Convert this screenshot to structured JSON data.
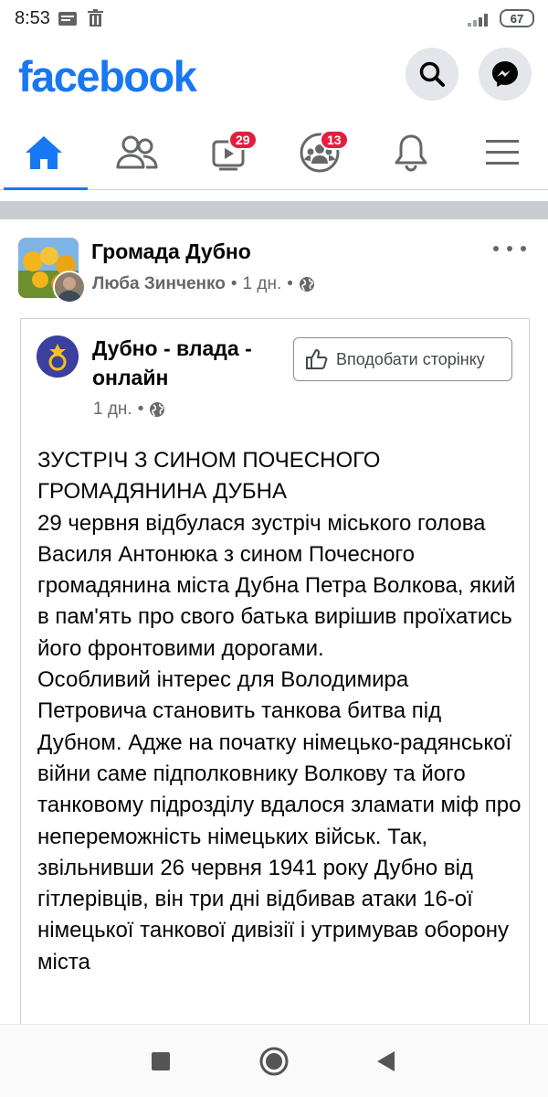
{
  "status_bar": {
    "time": "8:53",
    "battery": "67"
  },
  "header": {
    "logo": "facebook",
    "brand_color": "#1877f2",
    "search_icon": "search-icon",
    "messenger_icon": "messenger-icon"
  },
  "nav": {
    "tabs": [
      {
        "name": "home",
        "icon": "home-icon",
        "active": true
      },
      {
        "name": "friends",
        "icon": "friends-icon"
      },
      {
        "name": "watch",
        "icon": "video-icon",
        "badge": "29"
      },
      {
        "name": "groups",
        "icon": "groups-icon",
        "badge": "13"
      },
      {
        "name": "notifications",
        "icon": "bell-icon"
      },
      {
        "name": "menu",
        "icon": "menu-icon"
      }
    ]
  },
  "post": {
    "group_name": "Громада Дубно",
    "author": "Люба Зинченко",
    "time": "1 дн.",
    "shared": {
      "page_name": "Дубно - влада - онлайн",
      "like_button": "Вподобати сторінку",
      "time": "1 дн.",
      "paragraphs": [
        "ЗУСТРІЧ З СИНОМ ПОЧЕСНОГО ГРОМАДЯНИНА ДУБНА",
        "29 червня відбулася зустріч міського голова Василя Антонюка з сином Почесного громадянина міста Дубна Петра Волкова, який в пам'ять про свого батька вирішив проїхатись його фронтовими дорогами.",
        "Особливий інтерес для Володимира Петровича становить танкова битва під Дубном. Адже на початку німецько-радянської війни саме підполковнику Волкову та його танковому підрозділу вдалося зламати міф про непереможність німецьких військ. Так, звільнивши 26 червня 1941 року Дубно від гітлерівців, він три дні відбивав атаки 16-ої німецької танкової дивізії і утримував оборону міста"
      ]
    }
  }
}
